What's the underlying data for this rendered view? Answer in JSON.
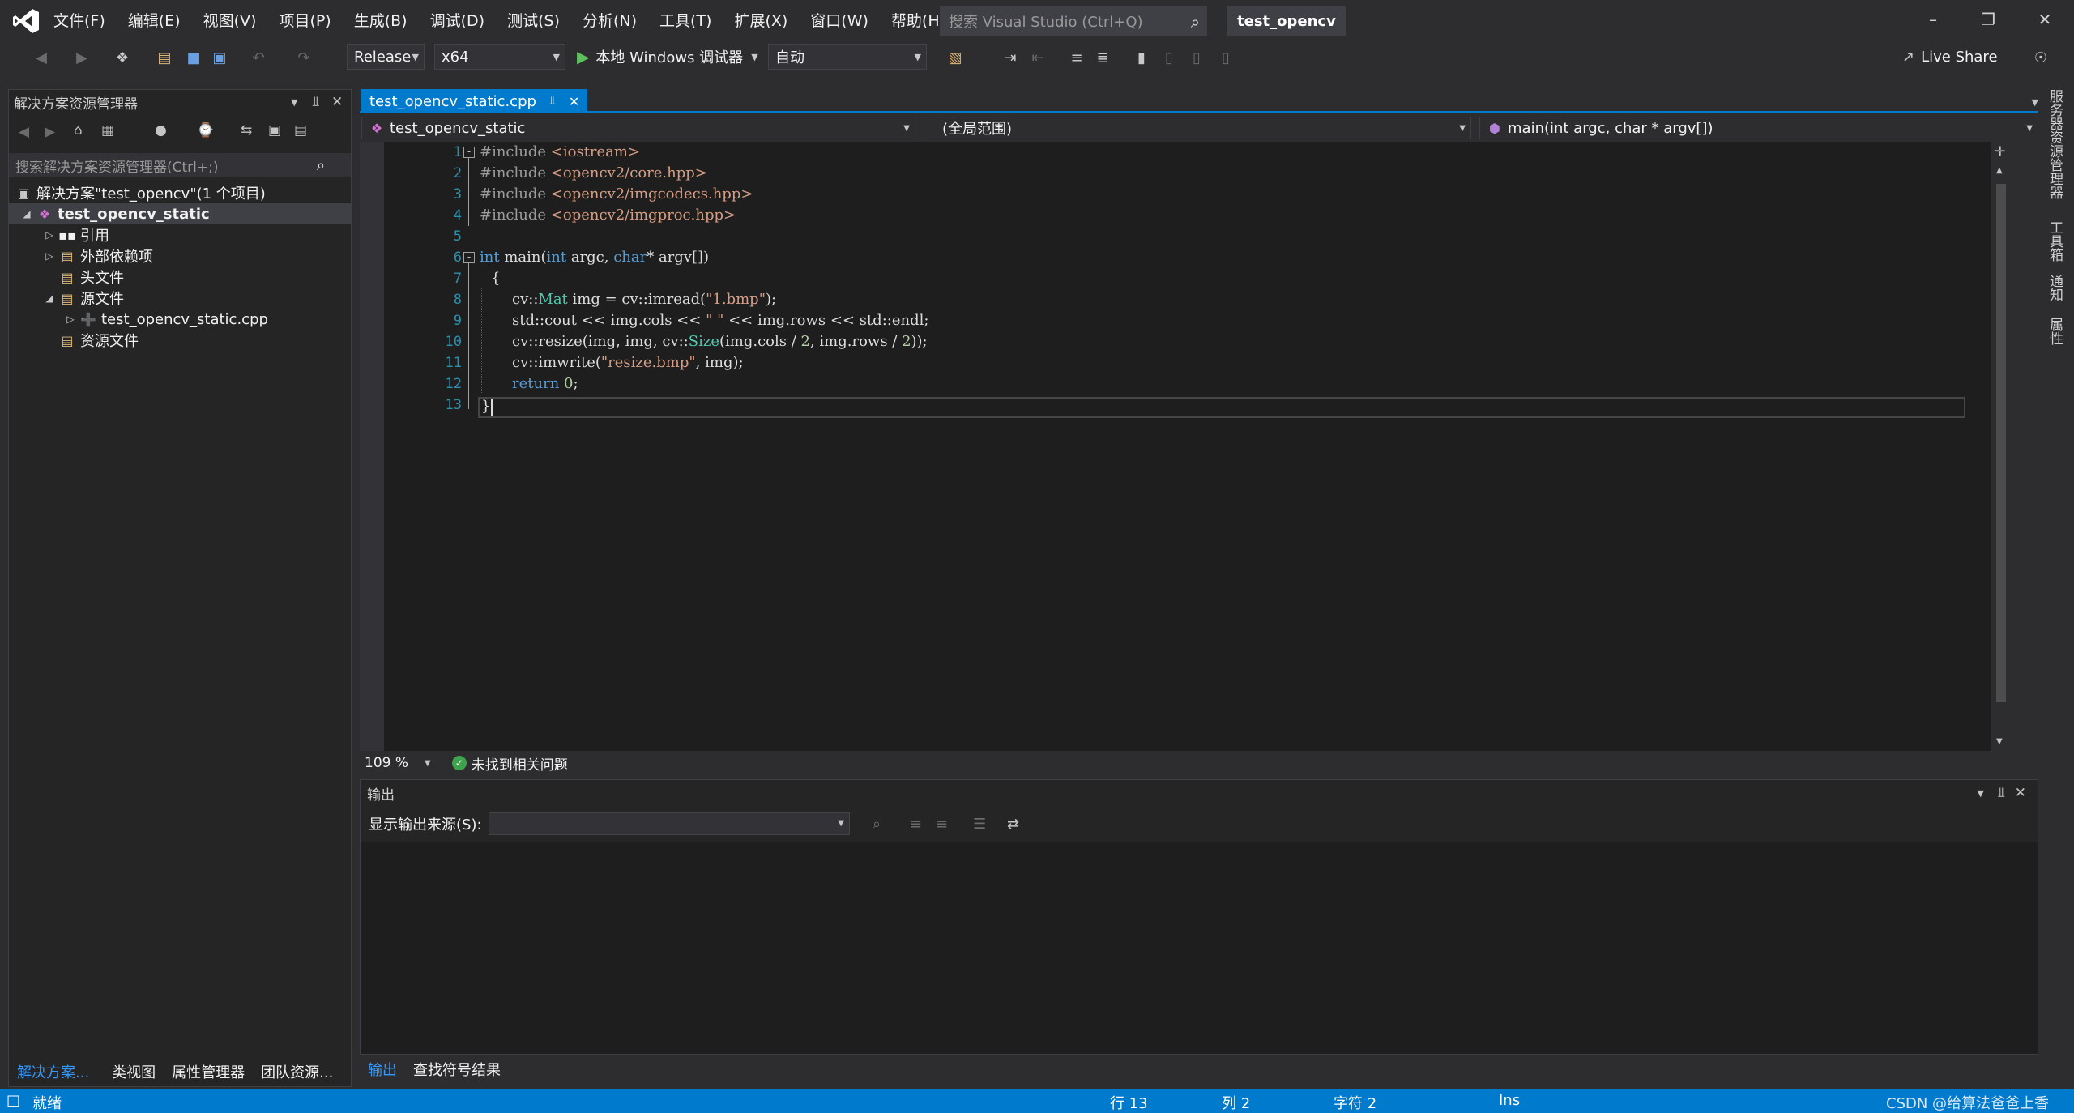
{
  "menu": [
    "文件(F)",
    "编辑(E)",
    "视图(V)",
    "项目(P)",
    "生成(B)",
    "调试(D)",
    "测试(S)",
    "分析(N)",
    "工具(T)",
    "扩展(X)",
    "窗口(W)",
    "帮助(H)"
  ],
  "search": {
    "placeholder": "搜索 Visual Studio (Ctrl+Q)"
  },
  "solution_name": "test_opencv",
  "toolbar": {
    "config": "Release",
    "platform": "x64",
    "run_label": "本地 Windows 调试器",
    "auto_label": "自动",
    "liveshare": "Live Share"
  },
  "solution_explorer": {
    "title": "解决方案资源管理器",
    "search_placeholder": "搜索解决方案资源管理器(Ctrl+;)",
    "tree": {
      "solution": "解决方案\"test_opencv\"(1 个项目)",
      "project": "test_opencv_static",
      "references": "引用",
      "external_deps": "外部依赖项",
      "header_files": "头文件",
      "source_files": "源文件",
      "source_file": "test_opencv_static.cpp",
      "resource_files": "资源文件"
    },
    "tabs": [
      "解决方案...",
      "类视图",
      "属性管理器",
      "团队资源..."
    ]
  },
  "editor": {
    "tab_title": "test_opencv_static.cpp",
    "nav_project": "test_opencv_static",
    "nav_scope": "(全局范围)",
    "nav_member": "main(int argc, char * argv[])",
    "line_numbers": [
      "1",
      "2",
      "3",
      "4",
      "5",
      "6",
      "7",
      "8",
      "9",
      "10",
      "11",
      "12",
      "13"
    ],
    "code": {
      "l1_kw": "#include",
      "l1_inc": "<iostream>",
      "l2_kw": "#include",
      "l2_inc": "<opencv2/core.hpp>",
      "l3_kw": "#include",
      "l3_inc": "<opencv2/imgcodecs.hpp>",
      "l4_kw": "#include",
      "l4_inc": "<opencv2/imgproc.hpp>",
      "l6_a": "int",
      "l6_b": " main(",
      "l6_c": "int",
      "l6_d": " argc, ",
      "l6_e": "char",
      "l6_f": "* argv[])",
      "l7": "{",
      "l8_a": "cv::",
      "l8_b": "Mat",
      "l8_c": " img = cv::imread(",
      "l8_d": "\"1.bmp\"",
      "l8_e": ");",
      "l9_a": "std::cout << img.cols << ",
      "l9_b": "\" \"",
      "l9_c": " << img.rows << std::endl;",
      "l10_a": "cv::resize(img, img, cv::",
      "l10_b": "Size",
      "l10_c": "(img.cols / ",
      "l10_d": "2",
      "l10_e": ", img.rows / ",
      "l10_f": "2",
      "l10_g": "));",
      "l11_a": "cv::imwrite(",
      "l11_b": "\"resize.bmp\"",
      "l11_c": ", img);",
      "l12_a": "return",
      "l12_b": " ",
      "l12_c": "0",
      "l12_d": ";",
      "l13": "}"
    },
    "zoom": "109 %",
    "issues": "未找到相关问题"
  },
  "output": {
    "title": "输出",
    "source_label": "显示输出来源(S):",
    "tabs": [
      "输出",
      "查找符号结果"
    ]
  },
  "right_rail": [
    "服务器资源管理器",
    "工具箱",
    "通知",
    "属性"
  ],
  "status": {
    "ready": "就绪",
    "line": "行 13",
    "col": "列 2",
    "char": "字符 2",
    "ins": "Ins",
    "watermark": "CSDN @给算法爸爸上香"
  },
  "colors": {
    "accent": "#007acc",
    "editor_bg": "#1e1e1e",
    "chrome_bg": "#2d2d30"
  }
}
